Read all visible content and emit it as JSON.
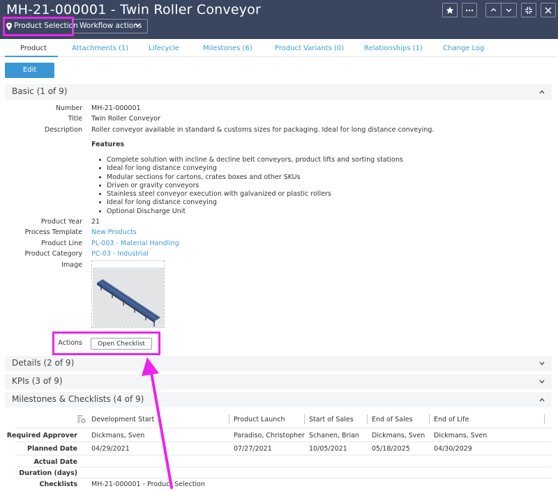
{
  "header": {
    "title": "MH-21-000001 - Twin Roller Conveyor",
    "context_label": "Product Selection",
    "workflow_label": "Workflow actions"
  },
  "tabs": [
    {
      "label": "Product"
    },
    {
      "label": "Attachments (1)"
    },
    {
      "label": "Lifecycle"
    },
    {
      "label": "Milestones (6)"
    },
    {
      "label": "Product Variants (0)"
    },
    {
      "label": "Relationships (1)"
    },
    {
      "label": "Change Log"
    }
  ],
  "edit_label": "Edit",
  "sections": {
    "basic": "Basic (1 of 9)",
    "details": "Details (2 of 9)",
    "kpis": "KPIs (3 of 9)",
    "milestones": "Milestones & Checklists (4 of 9)"
  },
  "basic": {
    "number_label": "Number",
    "number": "MH-21-000001",
    "title_label": "Title",
    "title": "Twin Roller Conveyor",
    "description_label": "Description",
    "description": "Roller conveyor available in standard & customs sizes for packaging. Ideal for long distance conveying.",
    "features_heading": "Features",
    "features": [
      "Complete solution with incline & decline belt conveyors, product lifts and sorting stations",
      "Ideal for long distance conveying",
      "Modular sections for cartons, crates boxes and other SKUs",
      "Driven or gravity conveyors",
      "Stainless steel conveyor execution with galvanized or plastic rollers",
      "Ideal for long distance conveying",
      "Optional Discharge Unit"
    ],
    "product_year_label": "Product Year",
    "product_year": "21",
    "process_template_label": "Process Template",
    "process_template": "New Products",
    "product_line_label": "Product Line",
    "product_line": "PL-003 - Material Handling",
    "product_category_label": "Product Category",
    "product_category": "PC-03 - Industrial",
    "image_label": "Image",
    "actions_label": "Actions",
    "open_checklist_label": "Open Checklist"
  },
  "milestones_table": {
    "columns": [
      "Development Start",
      "Product Launch",
      "Start of Sales",
      "End of Sales",
      "End of Life"
    ],
    "rows": [
      {
        "label": "Required Approver",
        "values": [
          "Dickmans, Sven",
          "Paradiso, Christopher",
          "Schanen, Brian",
          "Dickmans, Sven",
          "Dickmans, Sven"
        ]
      },
      {
        "label": "Planned Date",
        "values": [
          "04/29/2021",
          "07/27/2021",
          "10/05/2021",
          "05/18/2025",
          "04/30/2029"
        ]
      },
      {
        "label": "Actual Date",
        "values": [
          "",
          "",
          "",
          "",
          ""
        ]
      },
      {
        "label": "Duration (days)",
        "values": [
          "",
          "",
          "",
          "",
          ""
        ]
      }
    ],
    "checklists_label": "Checklists",
    "checklists_value": "MH-21-000001 - Product Selection"
  },
  "colors": {
    "header_bg": "#3a4660",
    "accent": "#3b97d3",
    "highlight": "#ee22ee"
  }
}
